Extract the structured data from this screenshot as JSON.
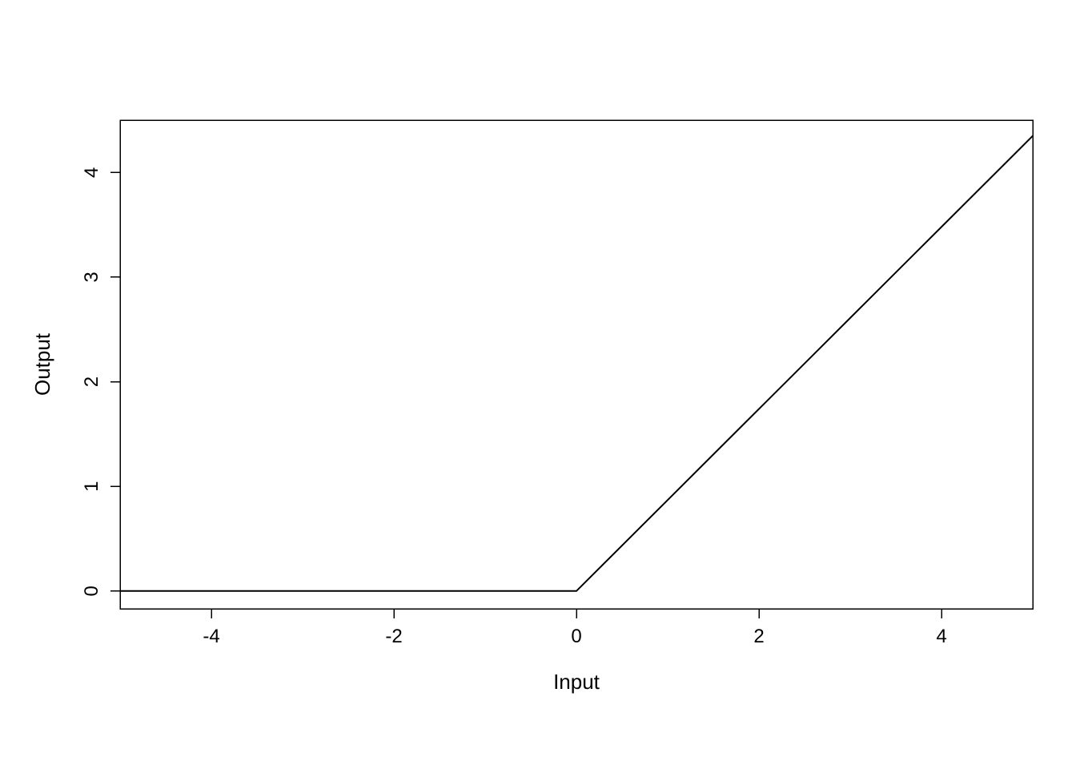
{
  "chart_data": {
    "type": "line",
    "x": [
      -5,
      -4,
      -3,
      -2,
      -1,
      0,
      1,
      2,
      3,
      4,
      5
    ],
    "y": [
      0,
      0,
      0,
      0,
      0,
      0,
      0.87,
      1.74,
      2.61,
      3.48,
      4.35
    ],
    "title": "",
    "xlabel": "Input",
    "ylabel": "Output",
    "xlim": [
      -5,
      5
    ],
    "ylim": [
      -0.17,
      4.5
    ],
    "xticks": [
      -4,
      -2,
      0,
      2,
      4
    ],
    "yticks": [
      0,
      1,
      2,
      3,
      4
    ],
    "grid": false
  },
  "colors": {
    "line": "#000000",
    "axis": "#000000",
    "background": "#ffffff"
  }
}
